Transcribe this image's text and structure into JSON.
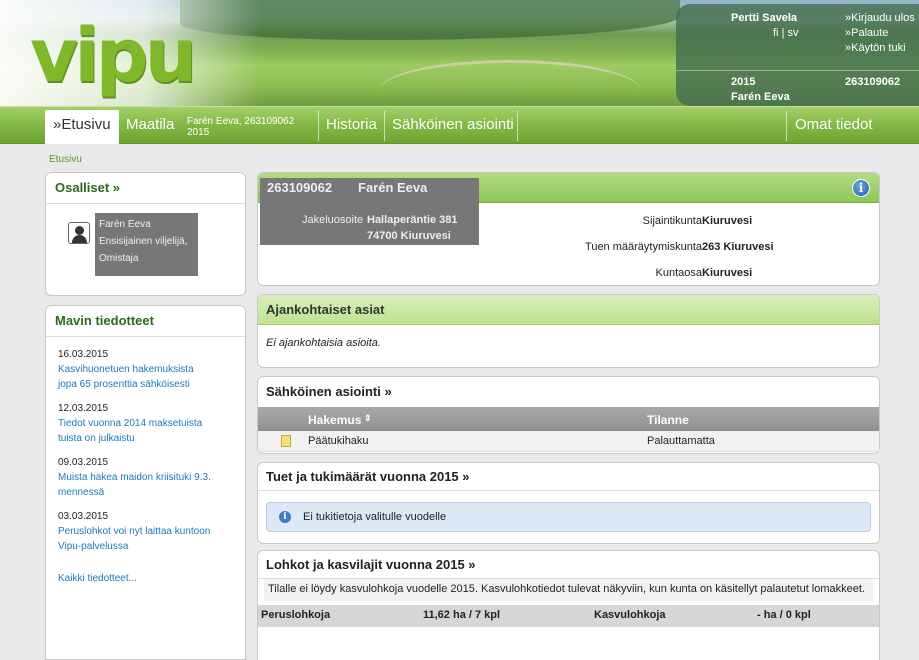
{
  "brand": {
    "logo_text": "vipu",
    "logo_color": "#7fb82b"
  },
  "user": {
    "name": "Pertti Savela",
    "lang_fi": "fi",
    "lang_sep": "|",
    "lang_sv": "sv",
    "links": [
      "»Kirjaudu ulos",
      "»Palaute",
      "»Käytön tuki"
    ],
    "year": "2015",
    "farm_id": "263109062",
    "farm_name": "Farén Eeva"
  },
  "nav": {
    "home": "»Etusivu",
    "farm": "Maatila",
    "farm_ctx_line1": "Farén Eeva, 263109062",
    "farm_ctx_line2": "2015",
    "history": "Historia",
    "e_service": "Sähköinen asiointi",
    "my_info": "Omat tiedot"
  },
  "breadcrumb": "Etusivu",
  "owners": {
    "title": "Osalliset »",
    "name": "Farén Eeva",
    "role_line1": "Ensisijainen viljelijä,",
    "role_line2": "Omistaja"
  },
  "bulletins": {
    "title": "Mavin tiedotteet",
    "items": [
      {
        "date": "16.03.2015",
        "line1": "Kasvihuonetuen hakemuksista",
        "line2": "jopa 65 prosenttia sähköisesti"
      },
      {
        "date": "12.03.2015",
        "line1": "Tiedot vuonna 2014 maksetuista",
        "line2": "tuista on julkaistu"
      },
      {
        "date": "09.03.2015",
        "line1": "Muista hakea maidon kriisituki 9.3.",
        "line2": "mennessä"
      },
      {
        "date": "03.03.2015",
        "line1": "Peruslohkot voi nyt laittaa kuntoon",
        "line2": "Vipu-palvelussa"
      }
    ],
    "all_link": "Kaikki tiedotteet..."
  },
  "farm_card": {
    "id": "263109062",
    "name": "Farén Eeva",
    "address_label": "Jakeluosoite",
    "address_line1": "Hallaperäntie 381",
    "address_line2": "74700  Kiuruvesi",
    "location_label": "Sijaintikunta",
    "location_value": "Kiuruvesi",
    "support_label": "Tuen määräytymiskunta",
    "support_value": "263 Kiuruvesi",
    "area_label": "Kuntaosa",
    "area_value": "Kiuruvesi",
    "info_glyph": "i"
  },
  "current": {
    "title": "Ajankohtaiset asiat",
    "message": "Ei ajankohtaisia asioita."
  },
  "e_service_box": {
    "title": "Sähköinen asiointi »",
    "col_application": "Hakemus",
    "sort_glyph": "⇕",
    "col_status": "Tilanne",
    "rows": [
      {
        "application": "Päätukihaku",
        "status": "Palauttamatta"
      }
    ]
  },
  "supports": {
    "title": "Tuet ja tukimäärät vuonna 2015 »",
    "info_glyph": "i",
    "message": "Ei tukitietoja valitulle vuodelle"
  },
  "parcels": {
    "title": "Lohkot ja kasvilajit vuonna 2015 »",
    "note": "Tilalle ei löydy kasvulohkoja vuodelle 2015. Kasvulohkotiedot tulevat näkyviin, kun kunta on käsitellyt palautetut lomakkeet.",
    "base_label": "Peruslohkoja",
    "base_value": "11,62 ha / 7 kpl",
    "growth_label": "Kasvulohkoja",
    "growth_value": "- ha / 0 kpl"
  }
}
